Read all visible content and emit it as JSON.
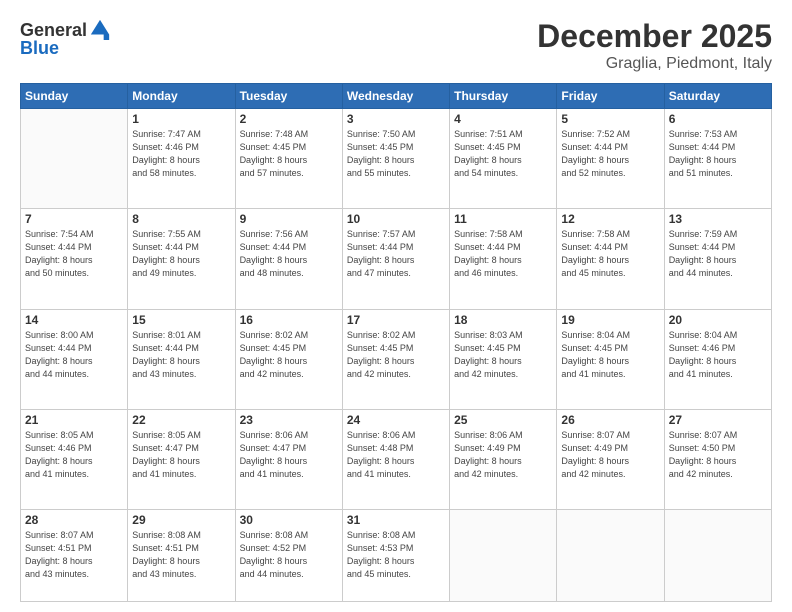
{
  "header": {
    "logo_general": "General",
    "logo_blue": "Blue",
    "month": "December 2025",
    "location": "Graglia, Piedmont, Italy"
  },
  "weekdays": [
    "Sunday",
    "Monday",
    "Tuesday",
    "Wednesday",
    "Thursday",
    "Friday",
    "Saturday"
  ],
  "weeks": [
    [
      {
        "day": "",
        "info": ""
      },
      {
        "day": "1",
        "info": "Sunrise: 7:47 AM\nSunset: 4:46 PM\nDaylight: 8 hours\nand 58 minutes."
      },
      {
        "day": "2",
        "info": "Sunrise: 7:48 AM\nSunset: 4:45 PM\nDaylight: 8 hours\nand 57 minutes."
      },
      {
        "day": "3",
        "info": "Sunrise: 7:50 AM\nSunset: 4:45 PM\nDaylight: 8 hours\nand 55 minutes."
      },
      {
        "day": "4",
        "info": "Sunrise: 7:51 AM\nSunset: 4:45 PM\nDaylight: 8 hours\nand 54 minutes."
      },
      {
        "day": "5",
        "info": "Sunrise: 7:52 AM\nSunset: 4:44 PM\nDaylight: 8 hours\nand 52 minutes."
      },
      {
        "day": "6",
        "info": "Sunrise: 7:53 AM\nSunset: 4:44 PM\nDaylight: 8 hours\nand 51 minutes."
      }
    ],
    [
      {
        "day": "7",
        "info": "Sunrise: 7:54 AM\nSunset: 4:44 PM\nDaylight: 8 hours\nand 50 minutes."
      },
      {
        "day": "8",
        "info": "Sunrise: 7:55 AM\nSunset: 4:44 PM\nDaylight: 8 hours\nand 49 minutes."
      },
      {
        "day": "9",
        "info": "Sunrise: 7:56 AM\nSunset: 4:44 PM\nDaylight: 8 hours\nand 48 minutes."
      },
      {
        "day": "10",
        "info": "Sunrise: 7:57 AM\nSunset: 4:44 PM\nDaylight: 8 hours\nand 47 minutes."
      },
      {
        "day": "11",
        "info": "Sunrise: 7:58 AM\nSunset: 4:44 PM\nDaylight: 8 hours\nand 46 minutes."
      },
      {
        "day": "12",
        "info": "Sunrise: 7:58 AM\nSunset: 4:44 PM\nDaylight: 8 hours\nand 45 minutes."
      },
      {
        "day": "13",
        "info": "Sunrise: 7:59 AM\nSunset: 4:44 PM\nDaylight: 8 hours\nand 44 minutes."
      }
    ],
    [
      {
        "day": "14",
        "info": "Sunrise: 8:00 AM\nSunset: 4:44 PM\nDaylight: 8 hours\nand 44 minutes."
      },
      {
        "day": "15",
        "info": "Sunrise: 8:01 AM\nSunset: 4:44 PM\nDaylight: 8 hours\nand 43 minutes."
      },
      {
        "day": "16",
        "info": "Sunrise: 8:02 AM\nSunset: 4:45 PM\nDaylight: 8 hours\nand 42 minutes."
      },
      {
        "day": "17",
        "info": "Sunrise: 8:02 AM\nSunset: 4:45 PM\nDaylight: 8 hours\nand 42 minutes."
      },
      {
        "day": "18",
        "info": "Sunrise: 8:03 AM\nSunset: 4:45 PM\nDaylight: 8 hours\nand 42 minutes."
      },
      {
        "day": "19",
        "info": "Sunrise: 8:04 AM\nSunset: 4:45 PM\nDaylight: 8 hours\nand 41 minutes."
      },
      {
        "day": "20",
        "info": "Sunrise: 8:04 AM\nSunset: 4:46 PM\nDaylight: 8 hours\nand 41 minutes."
      }
    ],
    [
      {
        "day": "21",
        "info": "Sunrise: 8:05 AM\nSunset: 4:46 PM\nDaylight: 8 hours\nand 41 minutes."
      },
      {
        "day": "22",
        "info": "Sunrise: 8:05 AM\nSunset: 4:47 PM\nDaylight: 8 hours\nand 41 minutes."
      },
      {
        "day": "23",
        "info": "Sunrise: 8:06 AM\nSunset: 4:47 PM\nDaylight: 8 hours\nand 41 minutes."
      },
      {
        "day": "24",
        "info": "Sunrise: 8:06 AM\nSunset: 4:48 PM\nDaylight: 8 hours\nand 41 minutes."
      },
      {
        "day": "25",
        "info": "Sunrise: 8:06 AM\nSunset: 4:49 PM\nDaylight: 8 hours\nand 42 minutes."
      },
      {
        "day": "26",
        "info": "Sunrise: 8:07 AM\nSunset: 4:49 PM\nDaylight: 8 hours\nand 42 minutes."
      },
      {
        "day": "27",
        "info": "Sunrise: 8:07 AM\nSunset: 4:50 PM\nDaylight: 8 hours\nand 42 minutes."
      }
    ],
    [
      {
        "day": "28",
        "info": "Sunrise: 8:07 AM\nSunset: 4:51 PM\nDaylight: 8 hours\nand 43 minutes."
      },
      {
        "day": "29",
        "info": "Sunrise: 8:08 AM\nSunset: 4:51 PM\nDaylight: 8 hours\nand 43 minutes."
      },
      {
        "day": "30",
        "info": "Sunrise: 8:08 AM\nSunset: 4:52 PM\nDaylight: 8 hours\nand 44 minutes."
      },
      {
        "day": "31",
        "info": "Sunrise: 8:08 AM\nSunset: 4:53 PM\nDaylight: 8 hours\nand 45 minutes."
      },
      {
        "day": "",
        "info": ""
      },
      {
        "day": "",
        "info": ""
      },
      {
        "day": "",
        "info": ""
      }
    ]
  ]
}
